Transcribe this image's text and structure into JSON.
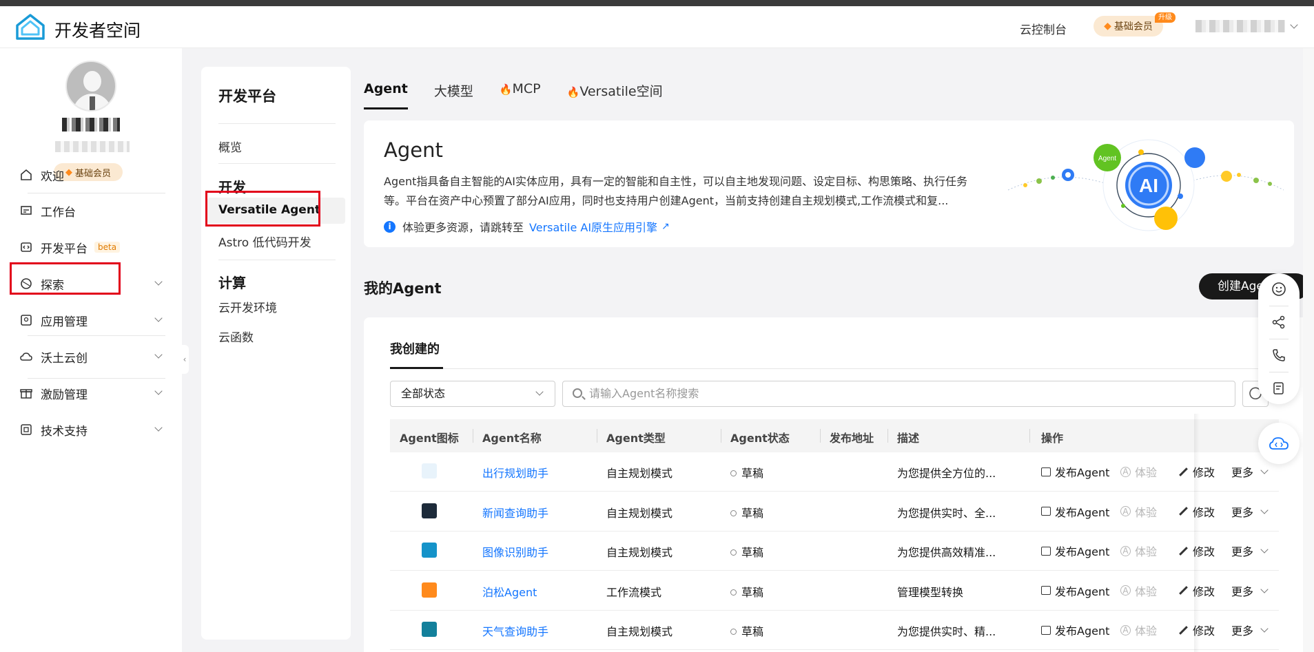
{
  "header": {
    "brand": "开发者空间",
    "console": "云控制台",
    "vip_label": "基础会员",
    "upgrade_badge": "升级"
  },
  "sidebar": {
    "vip_label": "基础会员",
    "items": [
      {
        "label": "欢迎",
        "icon": "home-icon"
      },
      {
        "label": "工作台",
        "icon": "workbench-icon"
      },
      {
        "label": "开发平台",
        "icon": "dev-platform-icon",
        "badge": "beta"
      },
      {
        "label": "探索",
        "icon": "explore-icon"
      },
      {
        "label": "应用管理",
        "icon": "app-manage-icon"
      },
      {
        "label": "沃土云创",
        "icon": "cloud-create-icon"
      },
      {
        "label": "激励管理",
        "icon": "gift-icon"
      },
      {
        "label": "技术支持",
        "icon": "support-icon"
      }
    ]
  },
  "subnav": {
    "title": "开发平台",
    "overview": "概览",
    "group_dev": "开发",
    "versatile_agent": "Versatile Agent",
    "astro": "Astro 低代码开发",
    "group_compute": "计算",
    "cloud_dev_env": "云开发环境",
    "cloud_func": "云函数"
  },
  "tabs": {
    "agent": "Agent",
    "llm": "大模型",
    "mcp": "MCP",
    "versatile_space": "Versatile空间"
  },
  "banner": {
    "title": "Agent",
    "desc": "Agent指具备自主智能的AI实体应用，具有一定的智能和自主性，可以自主地发现问题、设定目标、构思策略、执行任务等。平台在资产中心预置了部分AI应用，同时也支持用户创建Agent，当前支持创建自主规划模式,工作流模式和复...",
    "tip": "体验更多资源，请跳转至",
    "link": "Versatile AI原生应用引擎",
    "illus_agent": "Agent",
    "illus_ai": "AI"
  },
  "my_agent": {
    "title": "我的Agent",
    "create_button": "创建Agent",
    "tab_created": "我创建的",
    "status_select": "全部状态",
    "search_placeholder": "请输入Agent名称搜索"
  },
  "table": {
    "headers": [
      "Agent图标",
      "Agent名称",
      "Agent类型",
      "Agent状态",
      "发布地址",
      "描述",
      "操作"
    ],
    "rows": [
      {
        "icon_color": "#e8f3fb",
        "name": "出行规划助手",
        "type": "自主规划模式",
        "status": "草稿",
        "desc": "为您提供全方位的..."
      },
      {
        "icon_color": "#1d2b3a",
        "name": "新闻查询助手",
        "type": "自主规划模式",
        "status": "草稿",
        "desc": "为您提供实时、全..."
      },
      {
        "icon_color": "#1593c9",
        "name": "图像识别助手",
        "type": "自主规划模式",
        "status": "草稿",
        "desc": "为您提供高效精准..."
      },
      {
        "icon_color": "#ff8a1c",
        "name": "泊松Agent",
        "type": "工作流模式",
        "status": "草稿",
        "desc": "管理模型转换"
      },
      {
        "icon_color": "#13809b",
        "name": "天气查询助手",
        "type": "自主规划模式",
        "status": "草稿",
        "desc": "为您提供实时、精..."
      }
    ],
    "actions": {
      "publish": "发布Agent",
      "experience": "体验",
      "edit": "修改",
      "more": "更多"
    }
  }
}
